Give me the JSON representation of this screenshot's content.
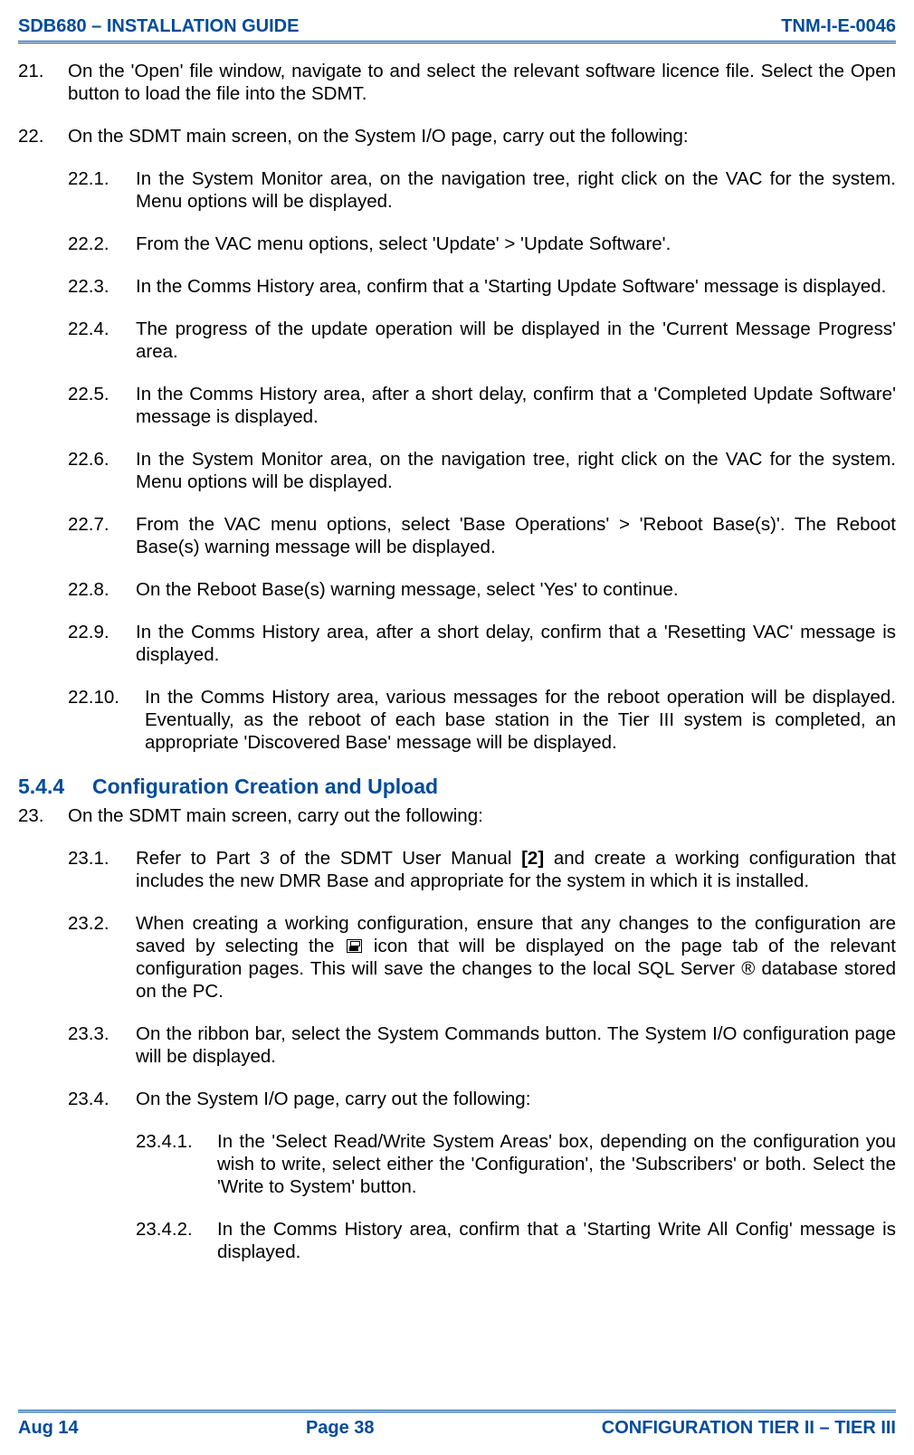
{
  "header": {
    "left": "SDB680 – INSTALLATION GUIDE",
    "right": "TNM-I-E-0046"
  },
  "footer": {
    "left": "Aug 14",
    "center": "Page 38",
    "right": "CONFIGURATION TIER II – TIER III"
  },
  "section": {
    "num": "5.4.4",
    "title": "Configuration Creation and Upload"
  },
  "items": {
    "i21": {
      "num": "21.",
      "text": "On the 'Open' file window, navigate to and select the relevant software licence file.  Select the Open button to load the file into the SDMT."
    },
    "i22": {
      "num": "22.",
      "text": "On the SDMT main screen, on the System I/O page, carry out the following:"
    },
    "i22_1": {
      "num": "22.1.",
      "text": "In the System Monitor area, on the navigation tree, right click on the VAC for the system.  Menu options will be displayed."
    },
    "i22_2": {
      "num": "22.2.",
      "text": "From the VAC menu options, select 'Update' > 'Update Software'."
    },
    "i22_3": {
      "num": "22.3.",
      "text": "In the Comms History area, confirm that a 'Starting Update Software' message is displayed."
    },
    "i22_4": {
      "num": "22.4.",
      "text": "The progress of the update operation will be displayed in the 'Current Message Progress' area."
    },
    "i22_5": {
      "num": "22.5.",
      "text": "In the Comms History area, after a short delay, confirm that a 'Completed Update Software' message is displayed."
    },
    "i22_6": {
      "num": "22.6.",
      "text": "In the System Monitor area, on the navigation tree, right click on the VAC for the system.  Menu options will be displayed."
    },
    "i22_7": {
      "num": "22.7.",
      "text": "From the VAC menu options, select 'Base Operations' > 'Reboot Base(s)'.  The Reboot Base(s) warning message will be displayed."
    },
    "i22_8": {
      "num": "22.8.",
      "text": "On the Reboot Base(s) warning message, select 'Yes' to continue."
    },
    "i22_9": {
      "num": "22.9.",
      "text": "In the Comms History area, after a short delay, confirm that a 'Resetting VAC' message is displayed."
    },
    "i22_10": {
      "num": "22.10.",
      "text": "In the Comms History area, various messages for the reboot operation will be displayed.  Eventually, as the reboot of each base station in the Tier III system is completed, an appropriate 'Discovered Base' message will be displayed."
    },
    "i23": {
      "num": "23.",
      "text": "On the SDMT main screen, carry out the following:"
    },
    "i23_1": {
      "num": "23.1.",
      "pre": "Refer to Part 3 of the SDMT User Manual ",
      "ref": "[2]",
      "post": " and create a working configuration that includes the new DMR Base and appropriate for the system in which it is installed."
    },
    "i23_2": {
      "num": "23.2.",
      "pre": "When creating a working configuration, ensure that any changes to the configuration are saved by selecting the ",
      "post": " icon that will be displayed on the page tab of the relevant configuration pages.  This will save the changes to the local SQL Server ® database stored on the PC."
    },
    "i23_3": {
      "num": "23.3.",
      "text": "On the ribbon bar, select the System Commands button.  The System I/O configuration page will be displayed."
    },
    "i23_4": {
      "num": "23.4.",
      "text": "On the System I/O page, carry out the following:"
    },
    "i23_4_1": {
      "num": "23.4.1.",
      "text": "In the 'Select Read/Write System Areas' box, depending on the configuration you wish to write, select either the 'Configuration', the 'Subscribers' or both.  Select the 'Write to System' button."
    },
    "i23_4_2": {
      "num": "23.4.2.",
      "text": "In the Comms History area, confirm that a 'Starting Write All Config' message is displayed."
    }
  }
}
